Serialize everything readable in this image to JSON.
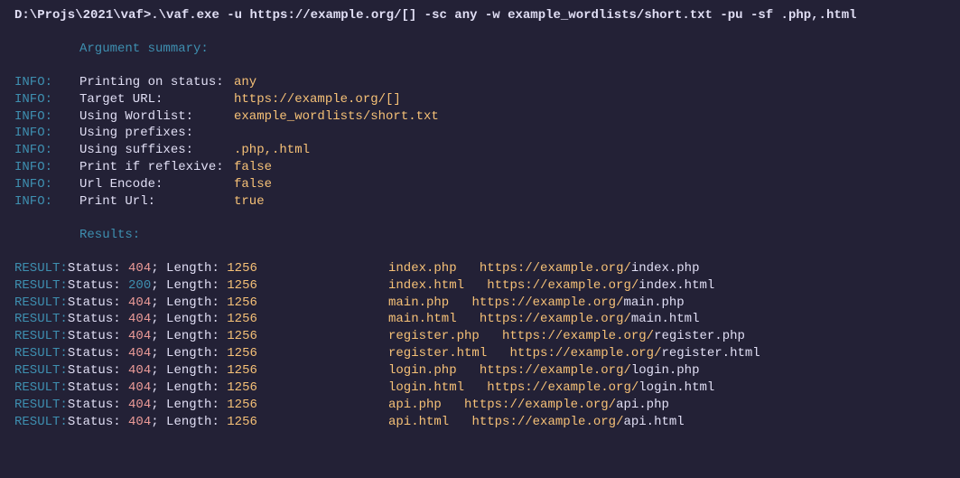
{
  "prompt": {
    "path": "D:\\Projs\\2021\\vaf>",
    "command": ".\\vaf.exe -u https://example.org/[] -sc any -w example_wordlists/short.txt -pu -sf .php,.html"
  },
  "argument_summary_header": "Argument summary:",
  "info_label": "INFO:",
  "info": [
    {
      "key": "Printing on status:",
      "value": "any"
    },
    {
      "key": "Target URL:",
      "value": "https://example.org/[]"
    },
    {
      "key": "Using Wordlist:",
      "value": "example_wordlists/short.txt"
    },
    {
      "key": "Using prefixes:",
      "value": ""
    },
    {
      "key": "Using suffixes:",
      "value": ".php,.html"
    },
    {
      "key": "Print if reflexive:",
      "value": "false"
    },
    {
      "key": "Url Encode:",
      "value": "false"
    },
    {
      "key": "Print Url:",
      "value": "true"
    }
  ],
  "results_header": "Results:",
  "result_label": "RESULT:",
  "status_prefix": "Status: ",
  "length_prefix": "; Length: ",
  "url_base": "https://example.org/",
  "results": [
    {
      "status": "404",
      "length": "1256",
      "word": "index.php",
      "path": "index.php"
    },
    {
      "status": "200",
      "length": "1256",
      "word": "index.html",
      "path": "index.html"
    },
    {
      "status": "404",
      "length": "1256",
      "word": "main.php",
      "path": "main.php"
    },
    {
      "status": "404",
      "length": "1256",
      "word": "main.html",
      "path": "main.html"
    },
    {
      "status": "404",
      "length": "1256",
      "word": "register.php",
      "path": "register.php"
    },
    {
      "status": "404",
      "length": "1256",
      "word": "register.html",
      "path": "register.html"
    },
    {
      "status": "404",
      "length": "1256",
      "word": "login.php",
      "path": "login.php"
    },
    {
      "status": "404",
      "length": "1256",
      "word": "login.html",
      "path": "login.html"
    },
    {
      "status": "404",
      "length": "1256",
      "word": "api.php",
      "path": "api.php"
    },
    {
      "status": "404",
      "length": "1256",
      "word": "api.html",
      "path": "api.html"
    }
  ]
}
